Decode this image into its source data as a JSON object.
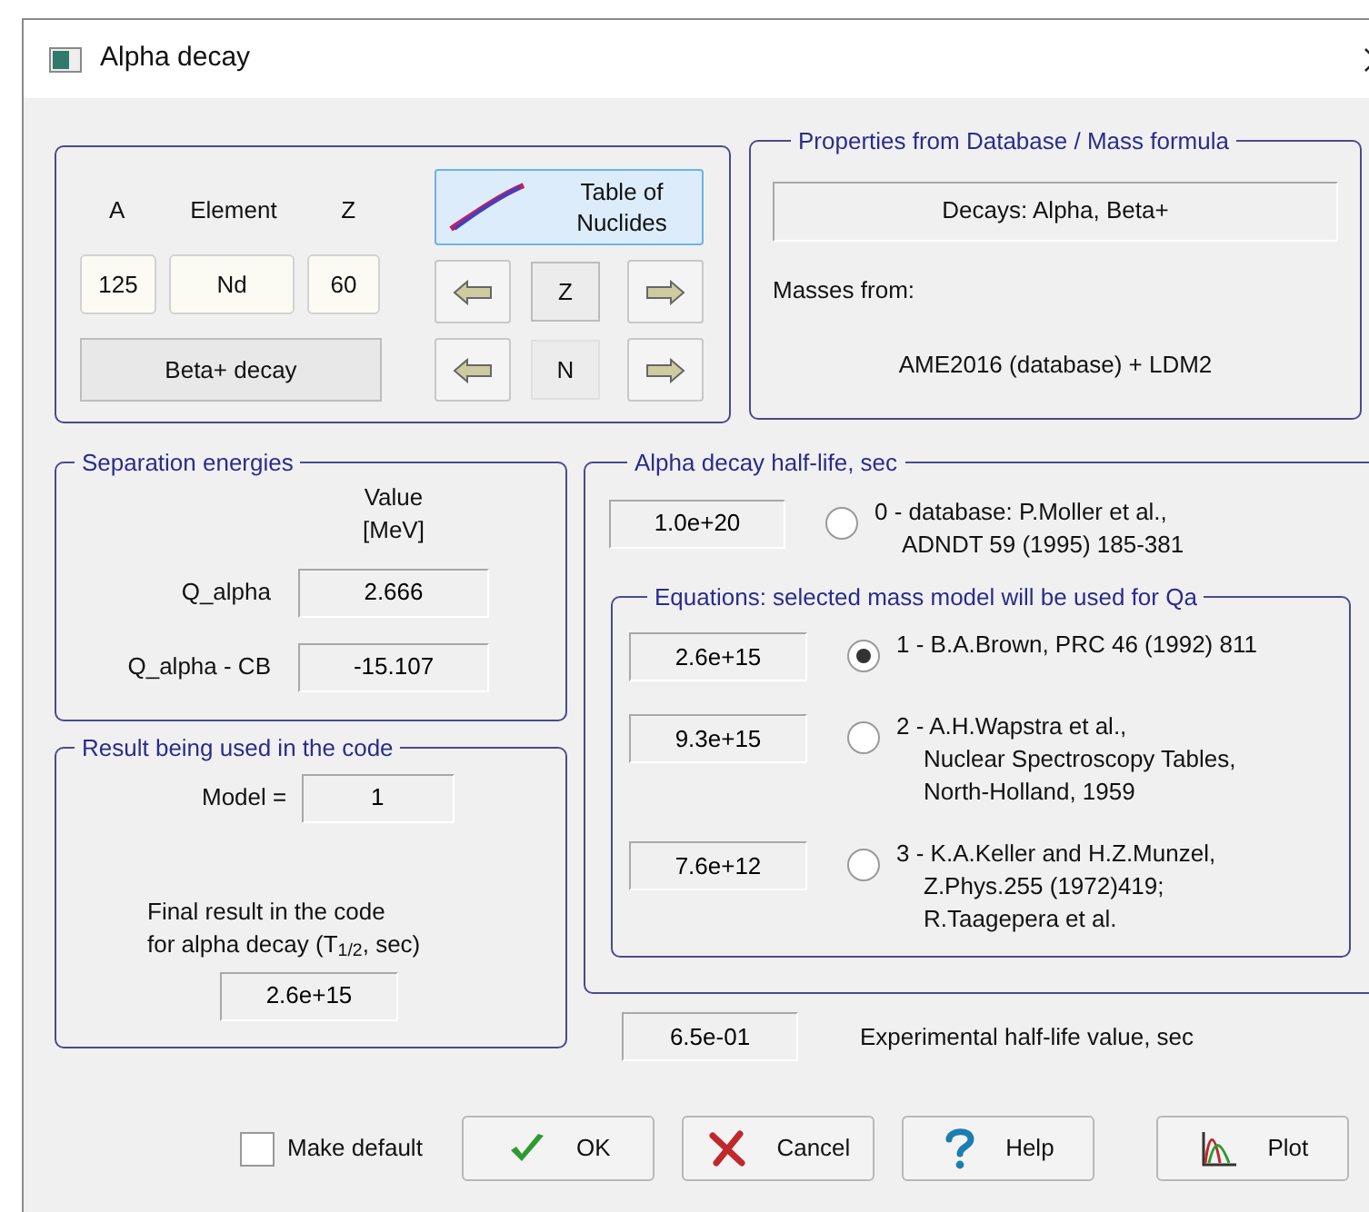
{
  "window": {
    "title": "Alpha decay"
  },
  "nuclide": {
    "labels": [
      "A",
      "Element",
      "Z"
    ],
    "values": [
      "125",
      "Nd",
      "60"
    ],
    "decay_button": "Beta+ decay",
    "table_button": "Table of Nuclides",
    "z_label": "Z",
    "n_label": "N"
  },
  "properties": {
    "title": "Properties from Database / Mass formula",
    "decays": "Decays: Alpha, Beta+",
    "masses_label": "Masses from:",
    "masses_value": "AME2016 (database) + LDM2"
  },
  "separation": {
    "title": "Separation energies",
    "value_header": [
      "Value",
      "[MeV]"
    ],
    "rows": [
      {
        "label": "Q_alpha",
        "value": "2.666"
      },
      {
        "label": "Q_alpha - CB",
        "value": "-15.107"
      }
    ]
  },
  "result": {
    "title": "Result being used in the code",
    "model_label": "Model =",
    "model_value": "1",
    "final_text": [
      "Final result in the code",
      "for alpha decay (T$_{1/2}$, sec)"
    ],
    "final_value": "2.6e+15"
  },
  "half_life": {
    "title": "Alpha decay half-life, sec",
    "database": {
      "value": "1.0e+20",
      "lines": [
        "0 - database: P.Moller et al.,",
        "ADNDT 59 (1995) 185-381"
      ],
      "selected": false
    },
    "equations": {
      "title": "Equations:  selected mass model will be used  for Qa",
      "models": [
        {
          "value": "2.6e+15",
          "lines": [
            "1 - B.A.Brown, PRC 46 (1992) 811"
          ],
          "selected": true
        },
        {
          "value": "9.3e+15",
          "lines": [
            "2 - A.H.Wapstra et al.,",
            "Nuclear Spectroscopy Tables,",
            "North-Holland, 1959"
          ],
          "selected": false
        },
        {
          "value": "7.6e+12",
          "lines": [
            "3 - K.A.Keller and H.Z.Munzel,",
            "Z.Phys.255 (1972)419;",
            "R.Taagepera et al."
          ],
          "selected": false
        }
      ]
    }
  },
  "experimental": {
    "value": "6.5e-01",
    "label": "Experimental half-life value, sec"
  },
  "make_default": {
    "label": "Make default",
    "checked": false
  },
  "buttons": [
    {
      "kind": "ok",
      "label": "OK"
    },
    {
      "kind": "cancel",
      "label": "Cancel"
    },
    {
      "kind": "help",
      "label": "Help"
    },
    {
      "kind": "plot",
      "label": "Plot"
    }
  ]
}
